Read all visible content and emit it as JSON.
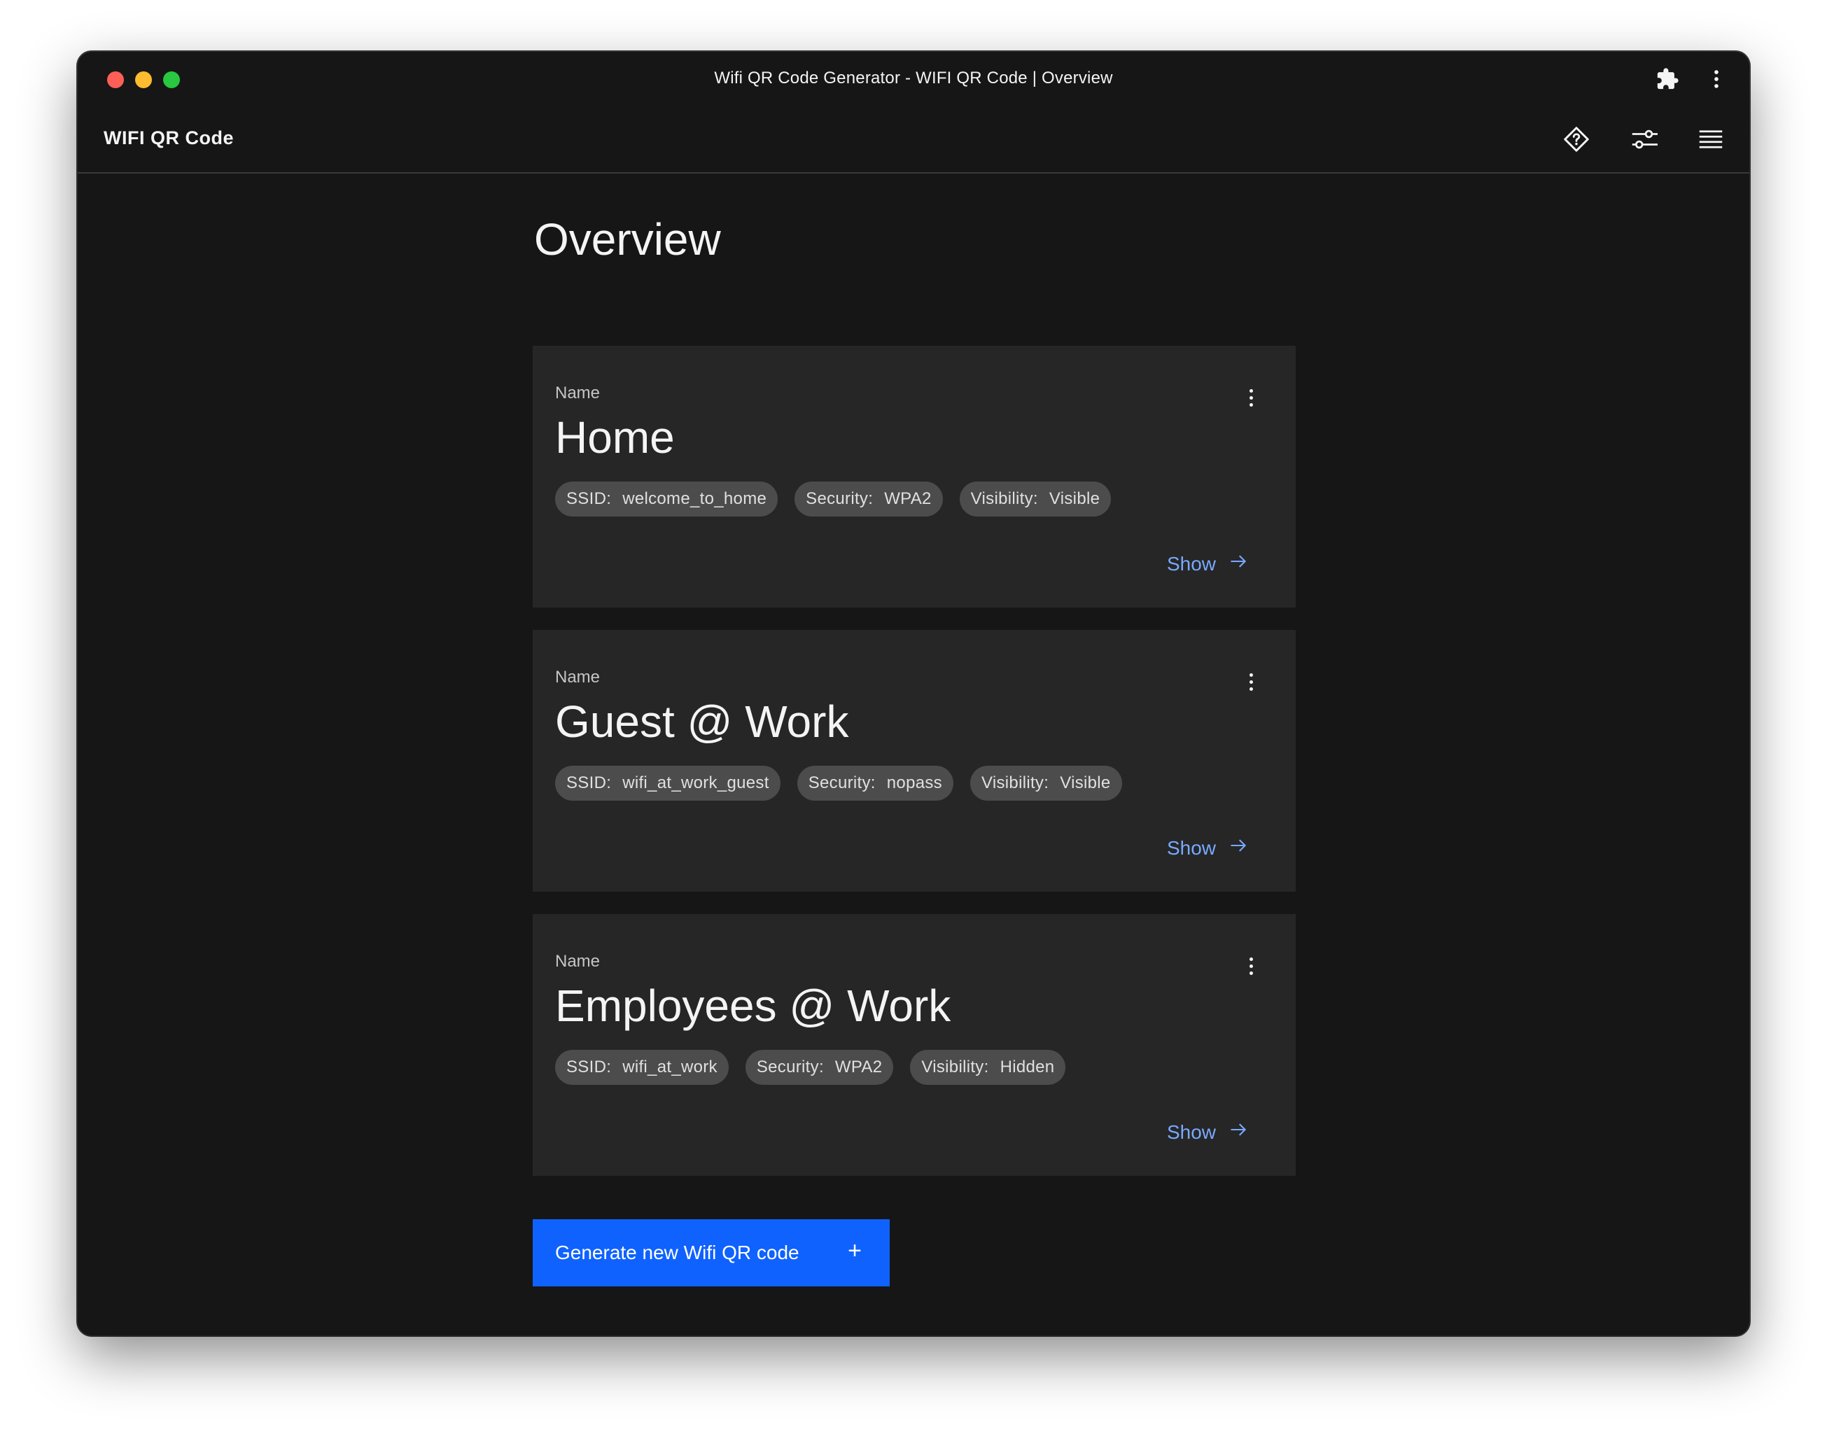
{
  "window": {
    "title": "Wifi QR Code Generator - WIFI QR Code | Overview"
  },
  "header": {
    "brand": "WIFI QR Code",
    "icons": [
      "help-diamond-icon",
      "settings-adjust-icon",
      "menu-icon"
    ]
  },
  "main": {
    "title": "Overview",
    "cards": [
      {
        "label": "Name",
        "name": "Home",
        "tags": [
          {
            "key": "SSID:",
            "value": "welcome_to_home"
          },
          {
            "key": "Security:",
            "value": "WPA2"
          },
          {
            "key": "Visibility:",
            "value": "Visible"
          }
        ],
        "action": "Show"
      },
      {
        "label": "Name",
        "name": "Guest @ Work",
        "tags": [
          {
            "key": "SSID:",
            "value": "wifi_at_work_guest"
          },
          {
            "key": "Security:",
            "value": "nopass"
          },
          {
            "key": "Visibility:",
            "value": "Visible"
          }
        ],
        "action": "Show"
      },
      {
        "label": "Name",
        "name": "Employees @ Work",
        "tags": [
          {
            "key": "SSID:",
            "value": "wifi_at_work"
          },
          {
            "key": "Security:",
            "value": "WPA2"
          },
          {
            "key": "Visibility:",
            "value": "Hidden"
          }
        ],
        "action": "Show"
      }
    ],
    "cta": {
      "label": "Generate new Wifi QR code",
      "icon": "+"
    }
  },
  "colors": {
    "background": "#161616",
    "card": "#262626",
    "tag": "#4c4c4c",
    "link": "#78a9ff",
    "primary": "#0f62fe"
  }
}
